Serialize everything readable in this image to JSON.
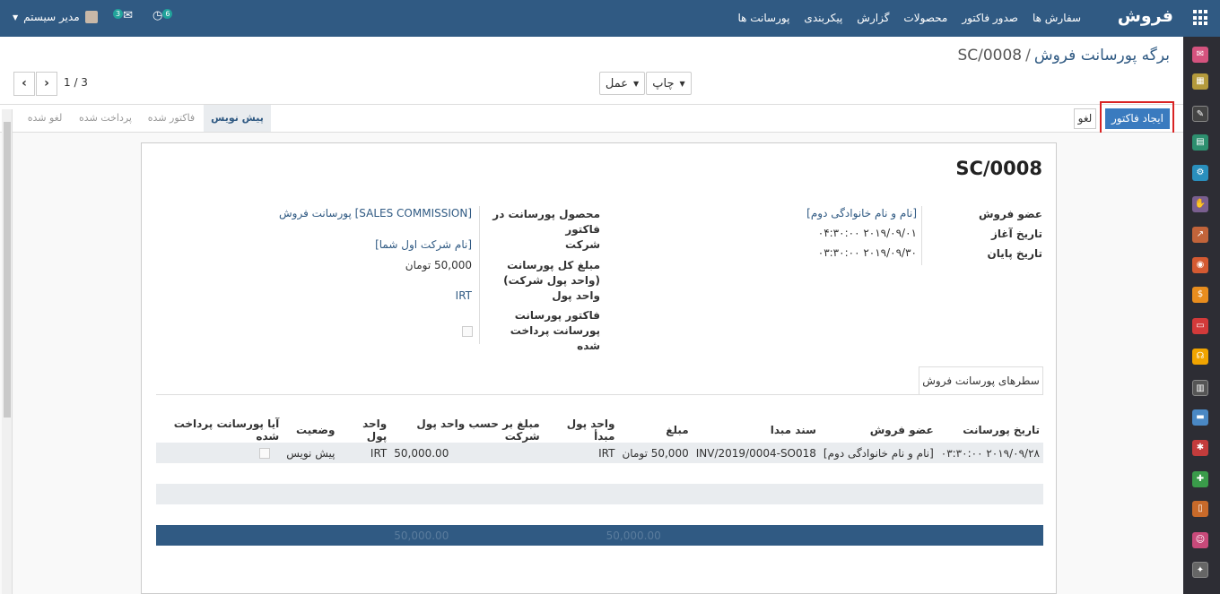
{
  "topbar": {
    "brand": "فروش",
    "menu": [
      "سفارش ها",
      "صدور فاکتور",
      "محصولات",
      "گزارش",
      "پیکربندی",
      "پورسانت ها"
    ],
    "user": "مدیر سیستم",
    "messages_count": "3",
    "activities_count": "6",
    "color": "#305a83"
  },
  "breadcrumb": {
    "parent": "برگه پورسانت فروش",
    "separator": "/",
    "current": "SC/0008"
  },
  "toolbar": {
    "print_label": "چاپ",
    "action_label": "عمل"
  },
  "pager": {
    "value": "1 / 3"
  },
  "status": {
    "create_invoice": "ایجاد فاکتور",
    "cancel": "لغو",
    "stages": [
      "پیش نویس",
      "فاکتور شده",
      "پرداخت شده",
      "لغو شده"
    ],
    "active_stage": "پیش نویس"
  },
  "form": {
    "name": "SC/0008",
    "left_fields": {
      "salesperson_label": "عضو فروش",
      "salesperson_value": "[نام و نام خانوادگی دوم]",
      "start_label": "تاریخ آغاز",
      "start_value": "۲۰۱۹/۰۹/۰۱ ۰۴:۳۰:۰۰",
      "end_label": "تاریخ پایان",
      "end_value": "۲۰۱۹/۰۹/۳۰ ۰۳:۳۰:۰۰"
    },
    "right_fields": {
      "product_label": "محصول پورسانت در فاکتور",
      "product_value": "[SALES COMMISSION] پورسانت فروش",
      "company_label": "شرکت",
      "company_value": "[نام شرکت اول شما]",
      "total_label": "مبلغ کل پورسانت (واحد پول شرکت)",
      "total_value": "50,000 تومان",
      "currency_label": "واحد پول",
      "currency_value": "IRT",
      "invoice_label": "فاکتور پورسانت",
      "paid_label": "پورسانت پرداخت شده"
    }
  },
  "notebook": {
    "tab": "سطرهای پورسانت فروش"
  },
  "lines": {
    "headers": [
      "تاریخ پورسانت",
      "عضو فروش",
      "سند مبدا",
      "مبلغ",
      "واحد پول مبدأ",
      "مبلغ بر حسب واحد پول شرکت",
      "واحد پول",
      "وضعیت",
      "آیا پورسانت پرداخت شده"
    ],
    "rows": [
      [
        "۲۰۱۹/۰۹/۲۸ ۰۳:۳۰:۰۰",
        "[نام و نام خانوادگی دوم]",
        "INV/2019/0004-SO018",
        "50,000 تومان",
        "IRT",
        "50,000.00",
        "IRT",
        "پیش نویس",
        ""
      ]
    ],
    "totals": {
      "amount": "50,000.00",
      "company_amount": "50,000.00"
    }
  }
}
